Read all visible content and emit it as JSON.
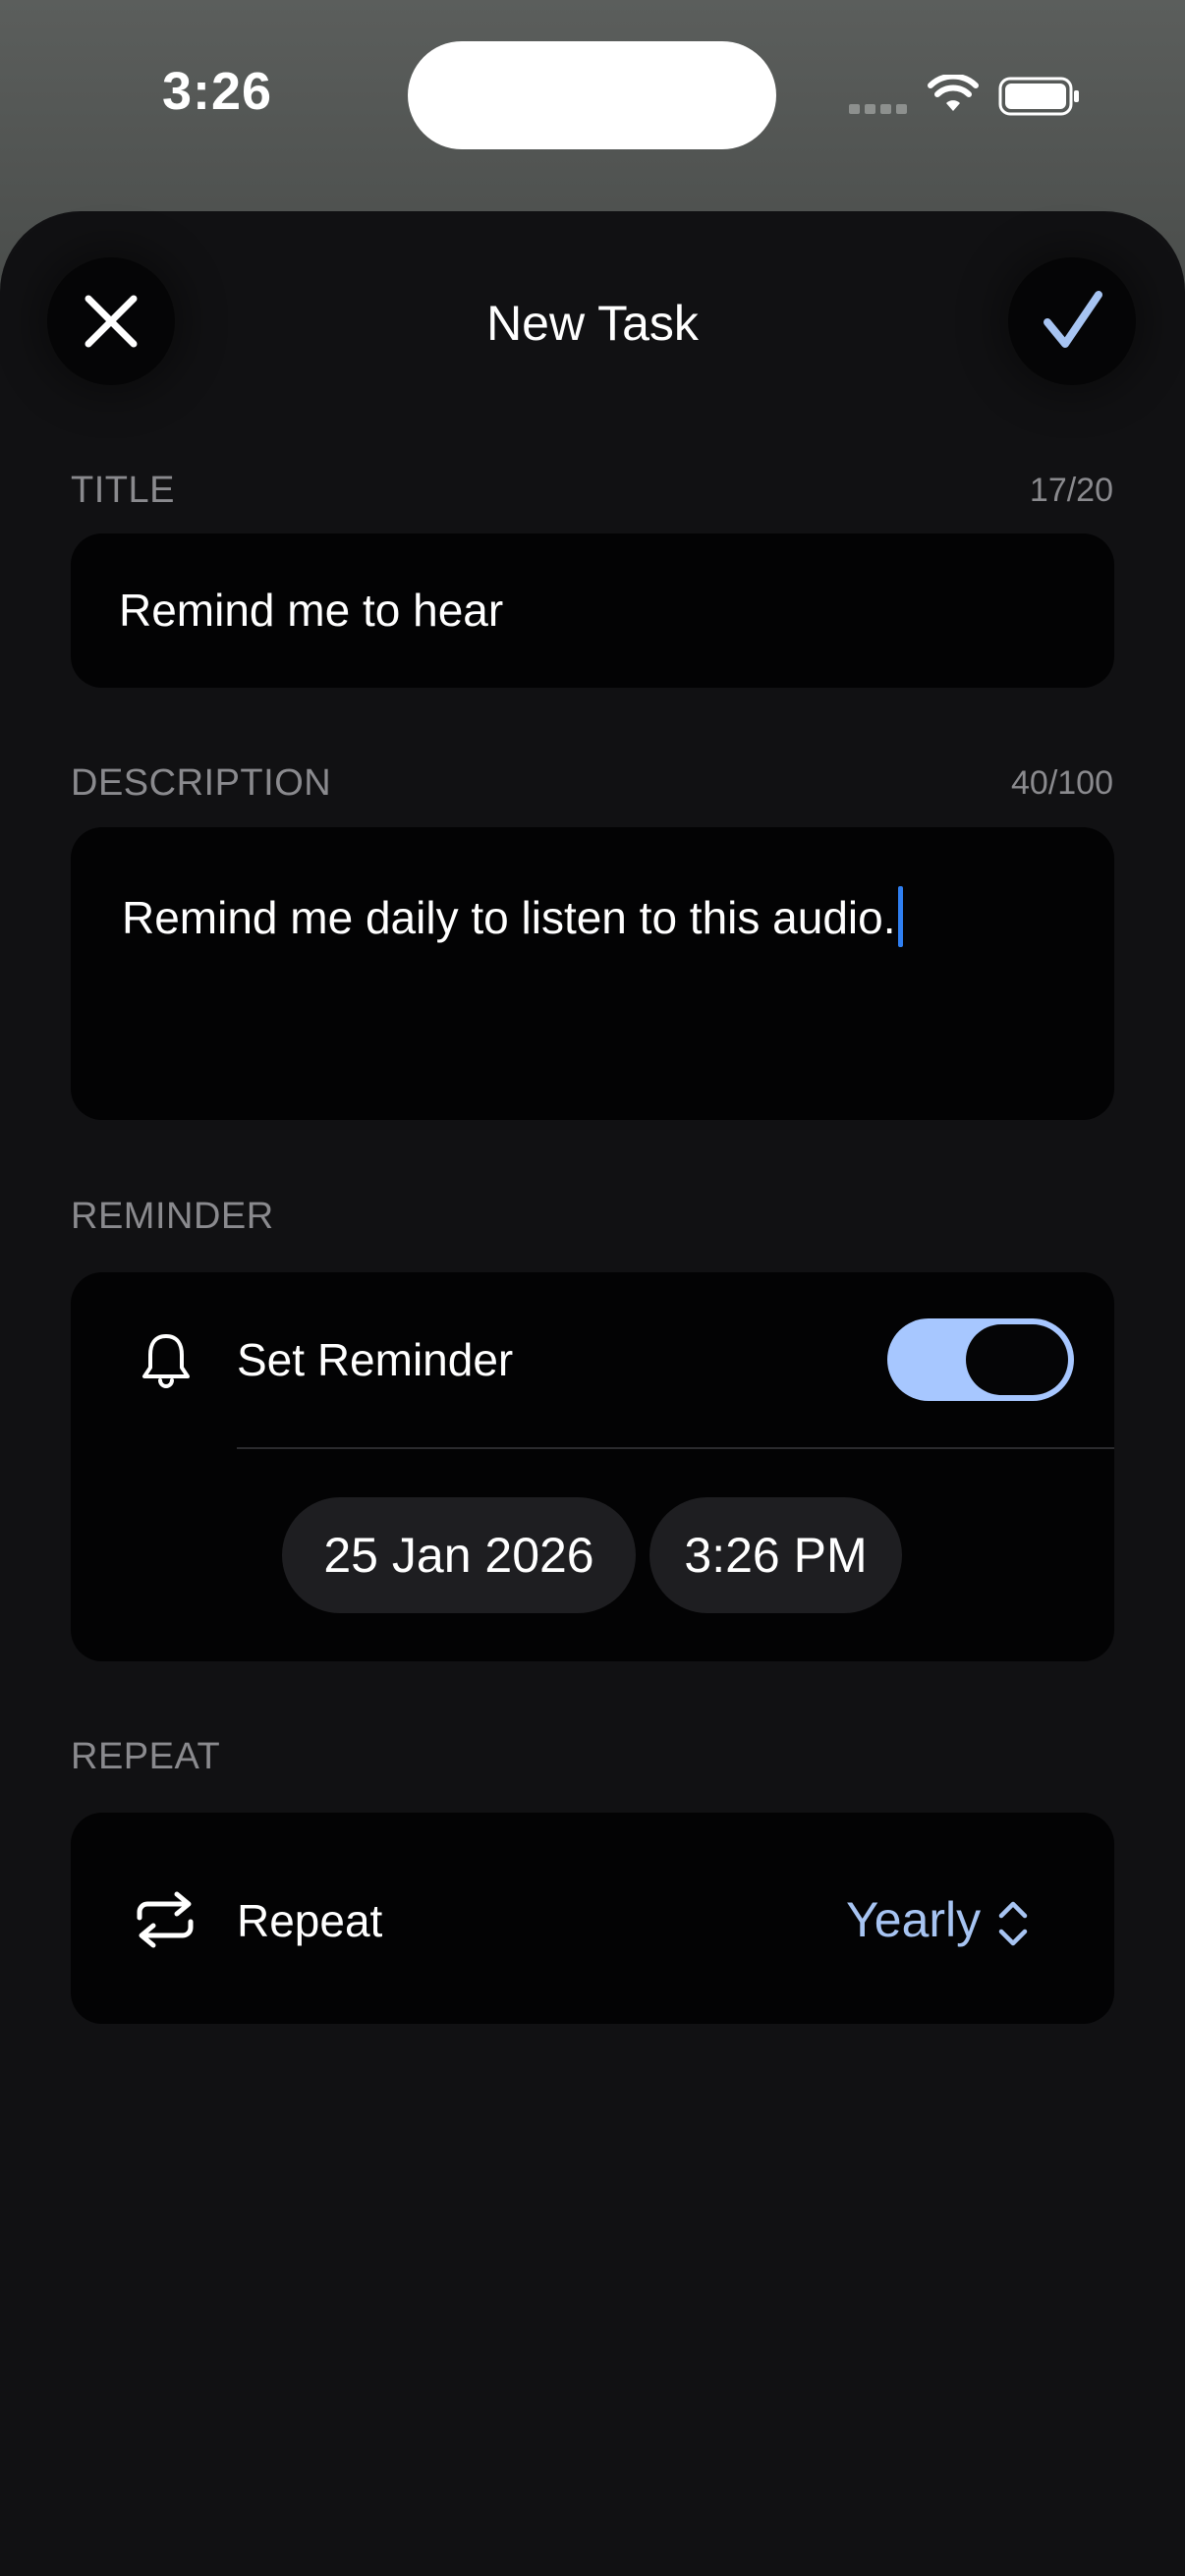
{
  "status_bar": {
    "time": "3:26",
    "icons": [
      "cellular-signal-icon",
      "wifi-icon",
      "battery-icon"
    ]
  },
  "header": {
    "title": "New Task",
    "close_icon": "close-icon",
    "confirm_icon": "checkmark-icon"
  },
  "title_section": {
    "label": "TITLE",
    "counter": "17/20",
    "value": "Remind me to hear"
  },
  "description_section": {
    "label": "DESCRIPTION",
    "counter": "40/100",
    "value": "Remind me daily to listen to this audio."
  },
  "reminder_section": {
    "label": "REMINDER",
    "row_label": "Set Reminder",
    "row_icon": "bell-icon",
    "toggle_on": true,
    "date": "25 Jan 2026",
    "time": "3:26 PM"
  },
  "repeat_section": {
    "label": "REPEAT",
    "row_label": "Repeat",
    "row_icon": "repeat-icon",
    "value": "Yearly",
    "value_icon": "chevron-up-down-icon"
  },
  "colors": {
    "accent": "#a7c4f2",
    "caret": "#2f7ff2",
    "sheet_bg": "#111113",
    "card_bg": "#030304"
  }
}
